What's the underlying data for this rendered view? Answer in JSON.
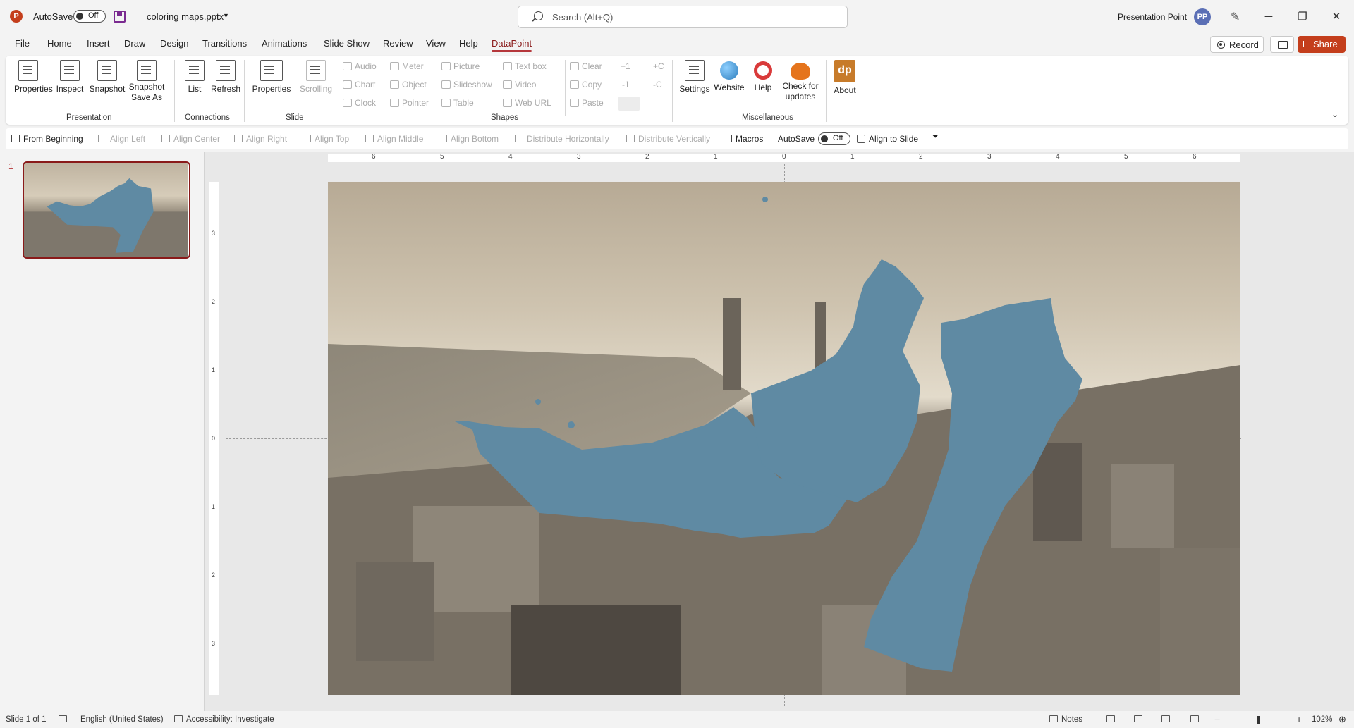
{
  "title_bar": {
    "autosave_label": "AutoSave",
    "autosave_state": "Off",
    "filename": "coloring maps.pptx",
    "search_placeholder": "Search (Alt+Q)",
    "user_name": "Presentation Point",
    "avatar_initials": "PP",
    "window_buttons": [
      "─",
      "❐",
      "✕"
    ]
  },
  "tabs": [
    "File",
    "Home",
    "Insert",
    "Draw",
    "Design",
    "Transitions",
    "Animations",
    "Slide Show",
    "Review",
    "View",
    "Help",
    "DataPoint"
  ],
  "active_tab": "DataPoint",
  "top_right": {
    "record_label": "Record",
    "share_label": "Share"
  },
  "ribbon": {
    "presentation": {
      "label": "Presentation",
      "buttons": [
        "Properties",
        "Inspect",
        "Snapshot",
        "Snapshot",
        "Save As"
      ]
    },
    "connections": {
      "label": "Connections",
      "buttons": [
        "List",
        "Refresh"
      ]
    },
    "slide": {
      "label": "Slide",
      "buttons": [
        "Properties",
        "Scrolling"
      ]
    },
    "shapes": {
      "label": "Shapes",
      "col1": [
        "Audio",
        "Chart",
        "Clock"
      ],
      "col2": [
        "Meter",
        "Object",
        "Pointer"
      ],
      "col3": [
        "Picture",
        "Slideshow",
        "Table"
      ],
      "col4": [
        "Text box",
        "Video",
        "Web URL"
      ],
      "col5": [
        "Clear",
        "Copy",
        "Paste"
      ],
      "col6": [
        "+1",
        "-1"
      ],
      "col7": [
        "+C",
        "-C"
      ]
    },
    "misc": {
      "label": "Miscellaneous",
      "buttons": [
        "Settings",
        "Website",
        "Help",
        "Check for",
        "updates"
      ],
      "about_label": "About",
      "about_logo": "dp"
    }
  },
  "qat": {
    "from_beginning": "From Beginning",
    "align_left": "Align Left",
    "align_center": "Align Center",
    "align_right": "Align Right",
    "align_top": "Align Top",
    "align_middle": "Align Middle",
    "align_bottom": "Align Bottom",
    "distribute_h": "Distribute Horizontally",
    "distribute_v": "Distribute Vertically",
    "macros": "Macros",
    "autosave": "AutoSave",
    "autosave_state": "Off",
    "align_to_slide": "Align to Slide"
  },
  "thumbnail": {
    "slide_number": "1"
  },
  "rulers": {
    "horizontal": [
      "6",
      "5",
      "4",
      "3",
      "2",
      "1",
      "0",
      "1",
      "2",
      "3",
      "4",
      "5",
      "6"
    ],
    "vertical": [
      "3",
      "2",
      "1",
      "0",
      "1",
      "2",
      "3"
    ]
  },
  "status_bar": {
    "slide_info": "Slide 1 of 1",
    "language": "English (United States)",
    "accessibility": "Accessibility: Investigate",
    "notes": "Notes",
    "zoom": "102%"
  },
  "colors": {
    "accent": "#b5373b",
    "share": "#c43e1c",
    "map_fill": "#5f8aa3",
    "photo_tone": "#b8a890"
  }
}
